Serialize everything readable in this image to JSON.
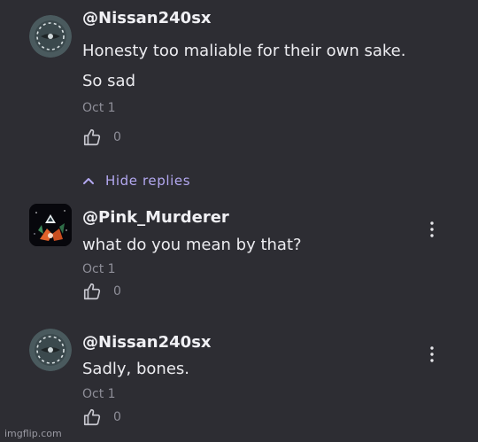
{
  "comments": [
    {
      "username": "@Nissan240sx",
      "lines": [
        "Honesty too maliable for their own sake.",
        "So sad"
      ],
      "date": "Oct 1",
      "likes": "0",
      "avatar_icon": "circle-avatar-icon"
    }
  ],
  "hide_replies_label": "Hide replies",
  "replies": [
    {
      "username": "@Pink_Murderer",
      "text": "what do you mean by that?",
      "date": "Oct 1",
      "likes": "0",
      "avatar_icon": "fox-avatar-icon"
    },
    {
      "username": "@Nissan240sx",
      "text": "Sadly, bones.",
      "date": "Oct 1",
      "likes": "0",
      "avatar_icon": "circle-avatar-icon"
    }
  ],
  "watermark": "imgflip.com",
  "colors": {
    "background": "#2d2d33",
    "accent": "#b3a8f0",
    "muted": "#8e8e98"
  }
}
